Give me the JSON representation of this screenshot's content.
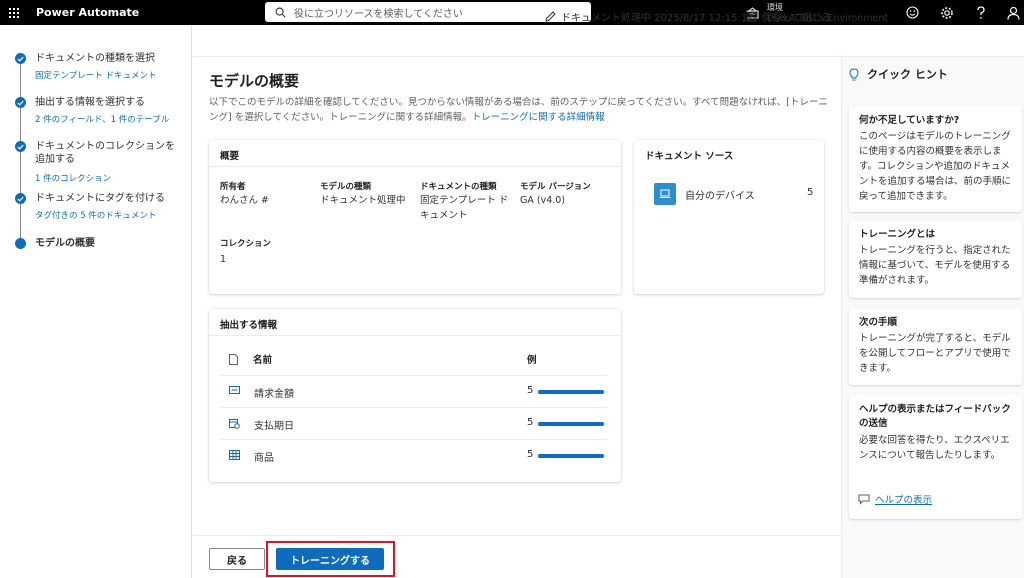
{
  "topbar": {
    "app_title": "Power Automate",
    "search_placeholder": "役に立つリソースを検索してください",
    "env_label": "環境",
    "env_name": "UserA Test's Environment"
  },
  "doc_bar": {
    "status": "ドキュメント処理中 2025/8/17 12:15:17",
    "save_close": "保存して閉じる"
  },
  "steps": [
    {
      "title": "ドキュメントの種類を選択",
      "sub": "固定テンプレート ドキュメント"
    },
    {
      "title": "抽出する情報を選択する",
      "sub": "2 件のフィールド、1 件のテーブル"
    },
    {
      "title": "ドキュメントのコレクションを追加する",
      "sub": "1 件のコレクション"
    },
    {
      "title": "ドキュメントにタグを付ける",
      "sub": "タグ付きの 5 件のドキュメント"
    },
    {
      "title": "モデルの概要",
      "sub": ""
    }
  ],
  "page": {
    "title": "モデルの概要",
    "desc": "以下でこのモデルの詳細を確認してください。見つからない情報がある場合は、前のステップに戻ってください。すべて問題なければ、[トレーニング] を選択してください。トレーニングに関する詳細情報。",
    "desc_link": "トレーニングに関する詳細情報"
  },
  "overview": {
    "heading": "概要",
    "owner_label": "所有者",
    "owner_value": "わんさん #",
    "model_type_label": "モデルの種類",
    "model_type_value": "ドキュメント処理中",
    "doc_type_label": "ドキュメントの種類",
    "doc_type_value": "固定テンプレート ドキュメント",
    "version_label": "モデル バージョン",
    "version_value": "GA (v4.0)",
    "collection_label": "コレクション",
    "collection_value": "1"
  },
  "sources": {
    "heading": "ドキュメント ソース",
    "items": [
      {
        "name": "自分のデバイス",
        "count": "5"
      }
    ]
  },
  "extract": {
    "heading": "抽出する情報",
    "col_name": "名前",
    "col_example": "例",
    "rows": [
      {
        "name": "請求金額",
        "count": "5",
        "icon": "text-field-icon",
        "fill": 1.0
      },
      {
        "name": "支払期日",
        "count": "5",
        "icon": "calendar-field-icon",
        "fill": 1.0
      },
      {
        "name": "商品",
        "count": "5",
        "icon": "table-icon",
        "fill": 1.0
      }
    ]
  },
  "buttons": {
    "back": "戻る",
    "train": "トレーニングする"
  },
  "hints": {
    "title": "クイック ヒント",
    "cards": [
      {
        "heading": "何か不足していますか?",
        "body": "このページはモデルのトレーニングに使用する内容の概要を表示します。コレクションや追加のドキュメントを追加する場合は、前の手順に戻って追加できます。"
      },
      {
        "heading": "トレーニングとは",
        "body": "トレーニングを行うと、指定された情報に基づいて、モデルを使用する準備がされます。"
      },
      {
        "heading": "次の手順",
        "body": "トレーニングが完了すると、モデルを公開してフローとアプリで使用できます。"
      },
      {
        "heading": "ヘルプの表示またはフィードバックの送信",
        "body": "必要な回答を得たり、エクスペリエンスについて報告したりします。"
      }
    ],
    "help_link": "ヘルプの表示"
  },
  "colors": {
    "accent": "#0f6cbd",
    "highlight": "#e81123"
  }
}
